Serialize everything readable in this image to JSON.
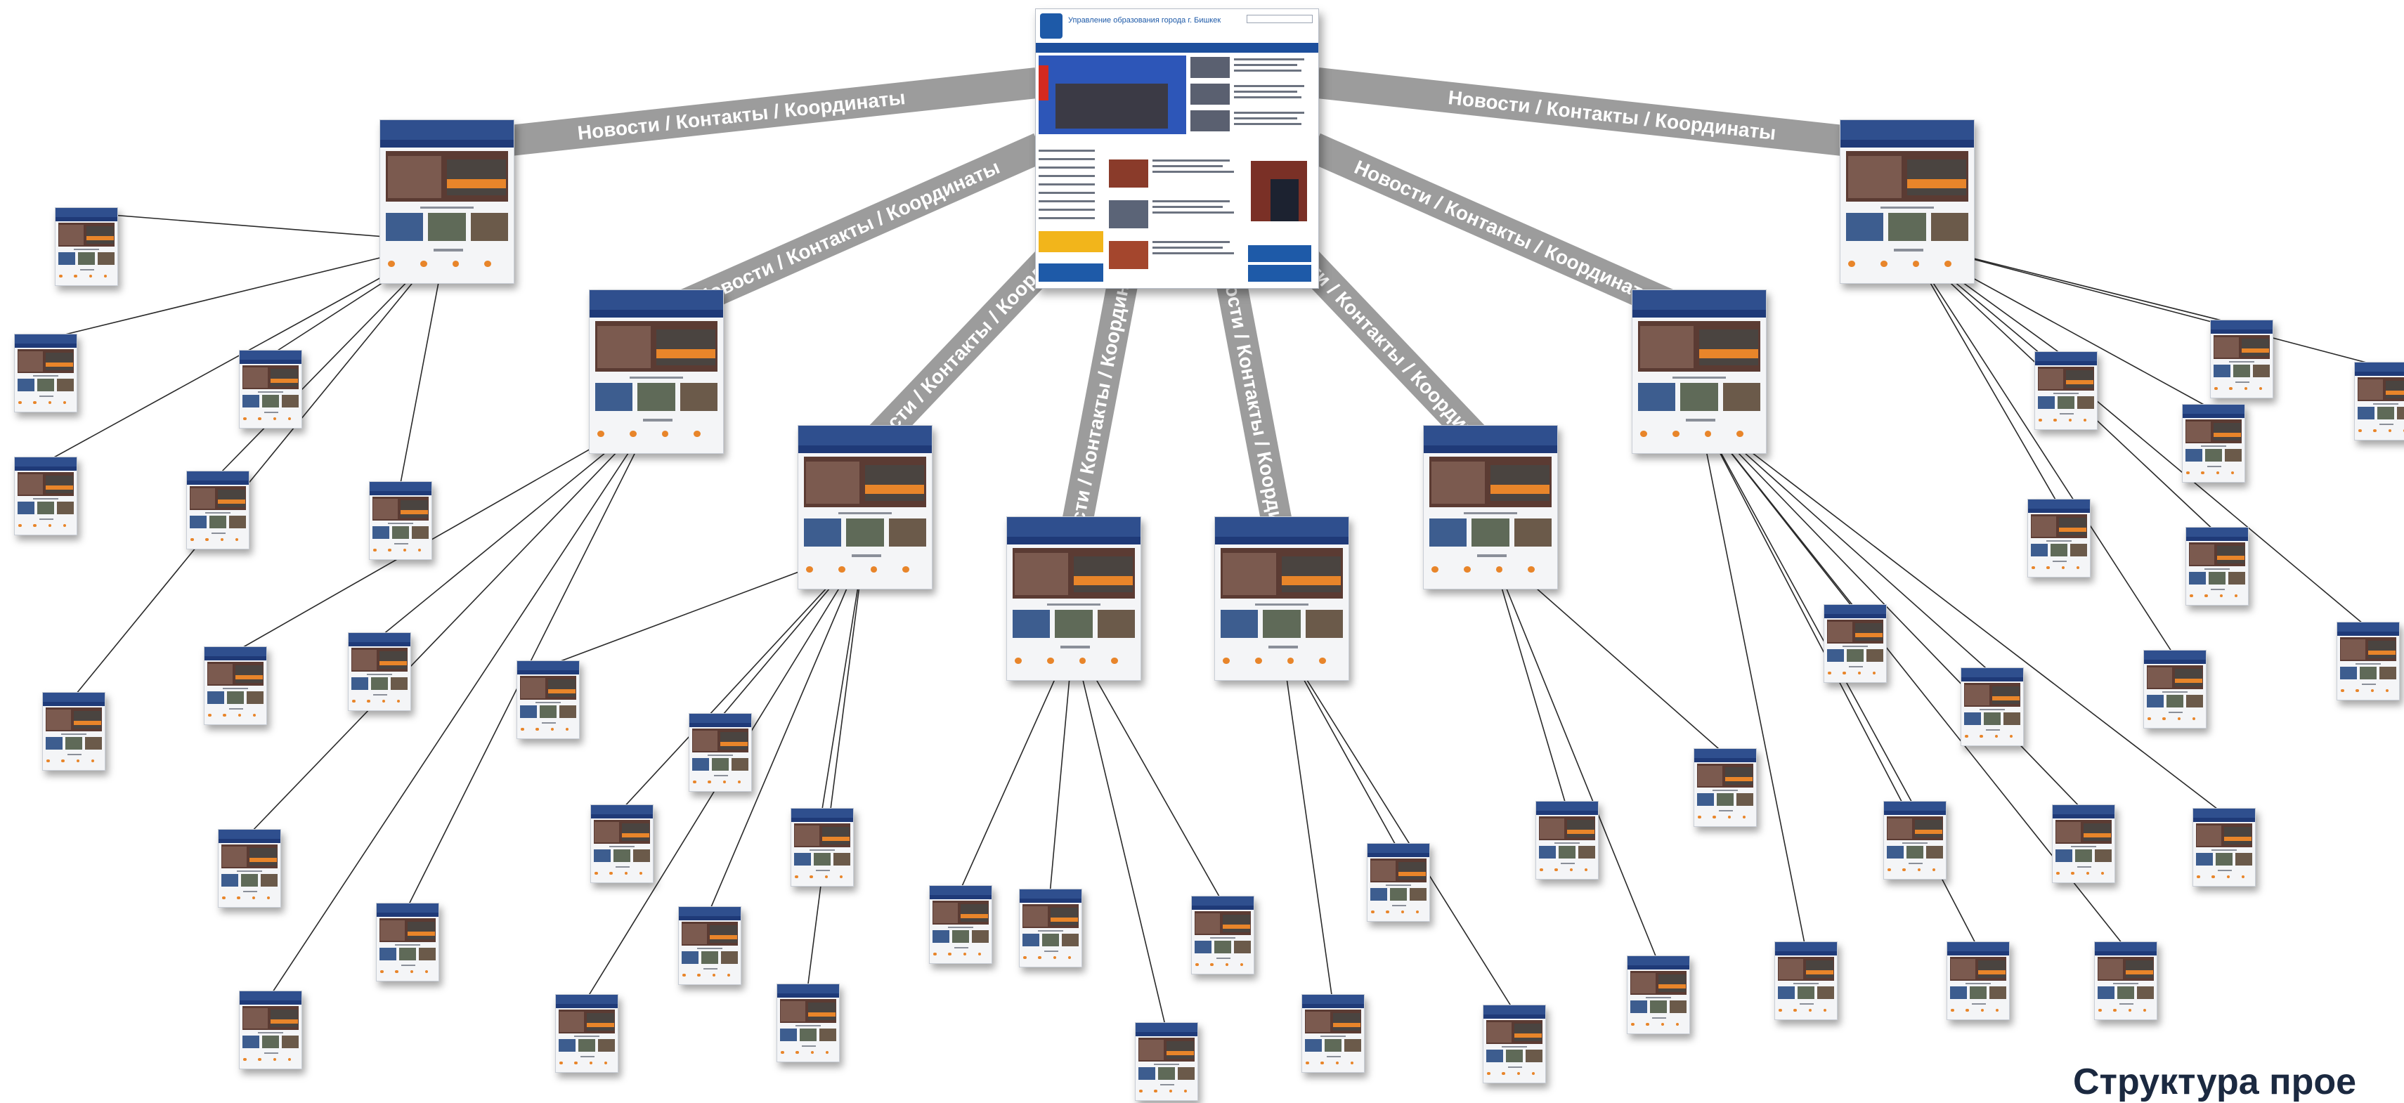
{
  "band_label": "Новости / Контакты / Координаты",
  "center_site": {
    "title": "Управление образования города г. Бишкек"
  },
  "footer": {
    "title": "Структура прое"
  },
  "colors": {
    "band": "#9c9c9c",
    "band_text": "#ffffff",
    "thumb_header": "#2f4f8e",
    "thumb_accent": "#e8852a",
    "connector": "#2a2a2a",
    "footer_text": "#1b2940"
  },
  "structure": {
    "root": "center-site",
    "level1_count": 8,
    "leaf_count": 66
  }
}
